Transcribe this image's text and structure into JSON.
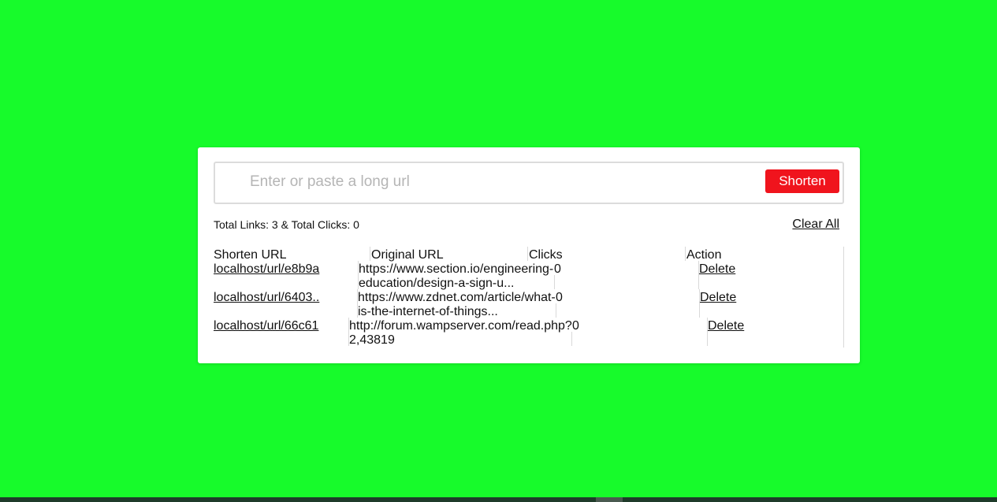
{
  "search": {
    "placeholder": "Enter or paste a long url",
    "button_label": "Shorten"
  },
  "summary": {
    "text": "Total Links: 3 & Total Clicks: 0",
    "clear_label": "Clear All"
  },
  "table": {
    "headers": [
      "Shorten URL",
      "Original URL",
      "Clicks",
      "Action"
    ],
    "rows": [
      {
        "short_url": "localhost/url/e8b9a",
        "original_line1": "https://www.section.io/engineering-",
        "original_line2": "education/design-a-sign-u...",
        "clicks": "0",
        "action": "Delete"
      },
      {
        "short_url": "localhost/url/6403..",
        "original_line1": "https://www.zdnet.com/article/what-",
        "original_line2": "is-the-internet-of-things...",
        "clicks": "0",
        "action": "Delete"
      },
      {
        "short_url": "localhost/url/66c61",
        "original_line1": "http://forum.wampserver.com/read.php?",
        "original_line2": "2,43819",
        "clicks": "0",
        "action": "Delete"
      }
    ]
  },
  "colors": {
    "background": "#17fb2b",
    "button": "#f0141d"
  }
}
